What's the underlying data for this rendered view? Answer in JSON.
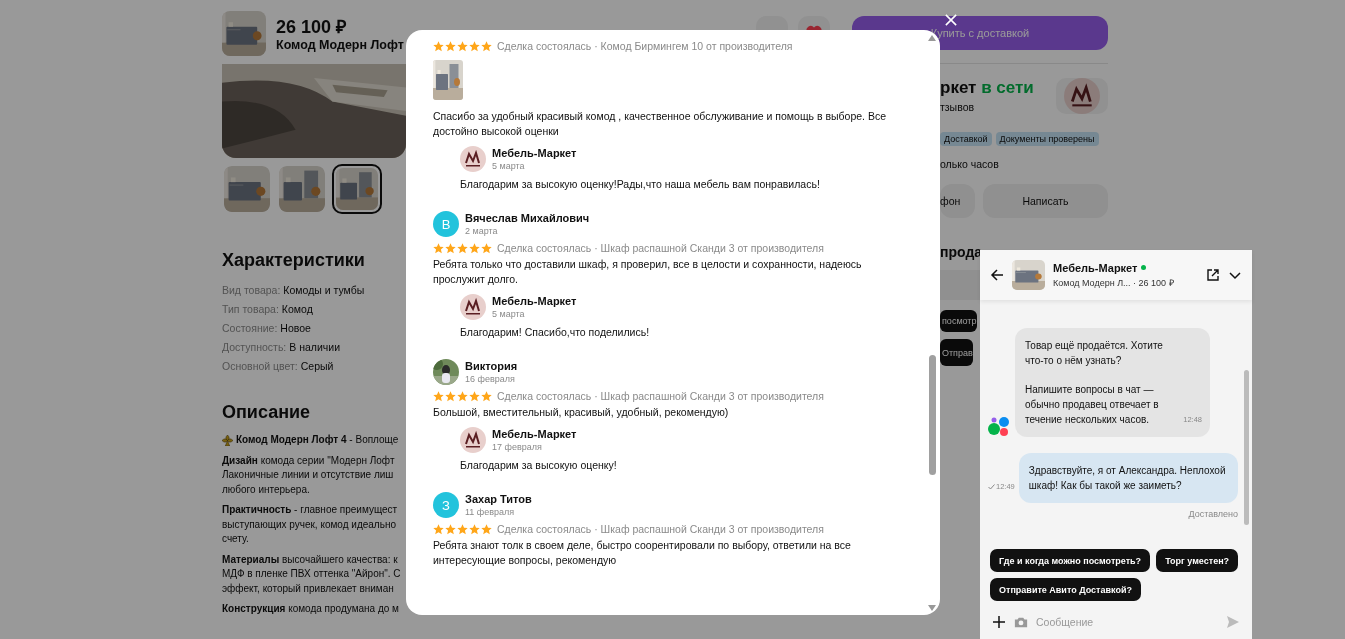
{
  "page": {
    "header": {
      "price": "26 100 ₽",
      "title": "Комод Модерн Лофт"
    },
    "thumbnails": [
      {
        "selected": false
      },
      {
        "selected": false
      },
      {
        "selected": true
      }
    ],
    "specs_title": "Характеристики",
    "specs": [
      {
        "label": "Вид товара:",
        "value": "Комоды и тумбы"
      },
      {
        "label": "Тип товара:",
        "value": "Комод"
      },
      {
        "label": "Состояние:",
        "value": "Новое"
      },
      {
        "label": "Доступность:",
        "value": "В наличии"
      },
      {
        "label": "Основной цвет:",
        "value": "Серый"
      }
    ],
    "description_title": "Описание",
    "description": [
      {
        "kind": "ornament",
        "lines": [
          "**Комод Модерн Лофт 4** - Воплоще"
        ]
      },
      {
        "lines": [
          "**Дизайн** комода серии \"Модерн Лофт",
          "Лаконичные линии и отсутствие лиш",
          "любого интерьера."
        ]
      },
      {
        "lines": [
          "**Практичность** - главное преимущест",
          "выступающих ручек, комод идеально",
          "счету."
        ]
      },
      {
        "lines": [
          "**Материалы** высочайшего качества: к",
          "МДФ в пленке ПВХ оттенка \"Айрон\". С",
          "эффект, который привлекает вниман"
        ]
      },
      {
        "lines": [
          "**Конструкция** комода продумана до м"
        ]
      }
    ],
    "buy_button": "Купить с доставкой",
    "seller": {
      "name": "ркет",
      "status": "в сети",
      "reviews": "тзывов"
    },
    "tags": [
      "Доставкой",
      "Документы проверены"
    ],
    "reply_time": "олько часов",
    "buttons": [
      "фон",
      "Написать"
    ],
    "section_title": "прода",
    "chips": [
      "посмотр",
      "Отправ"
    ]
  },
  "reviews_modal": {
    "reviews": [
      {
        "stars": 5,
        "deal": "Сделка состоялась · Комод Бирмингем 10 от производителя",
        "photo": true,
        "text": "Спасибо за удобный красивый комод , качественное обслуживание и помощь в выборе. Все достойно высокой оценки",
        "reply": {
          "author": "Мебель-Маркет",
          "date": "5 марта",
          "text": "Благодарим за высокую оценку!Рады,что наша мебель вам понравилась!"
        }
      },
      {
        "author": "Вячеслав Михайлович",
        "date": "2 марта",
        "avatar": {
          "kind": "letter",
          "letter": "В",
          "color": "#22c3dc"
        },
        "stars": 5,
        "deal": "Сделка состоялась · Шкаф распашной Сканди 3 от производителя",
        "text": "Ребята только что доставили шкаф, я проверил, все в целости и сохранности, надеюсь прослужит долго.",
        "reply": {
          "author": "Мебель-Маркет",
          "date": "5 марта",
          "text": "Благодарим! Спасибо,что поделились!"
        }
      },
      {
        "author": "Виктория",
        "date": "16 февраля",
        "stars": 5,
        "deal": "Сделка состоялась · Шкаф распашной Сканди 3 от производителя",
        "text": "Большой, вместительный, красивый, удобный, рекомендую)",
        "reply": {
          "author": "Мебель-Маркет",
          "date": "17 февраля",
          "text": "Благодарим за высокую оценку!"
        }
      },
      {
        "author": "Захар Титов",
        "date": "11 февраля",
        "avatar": {
          "kind": "letter",
          "letter": "З",
          "color": "#22c3dc"
        },
        "stars": 5,
        "deal": "Сделка состоялась · Шкаф распашной Сканди 3 от производителя",
        "text": "Ребята знают толк в своем деле, быстро соорентировали по выбору, ответили на все интересующие вопросы, рекомендую"
      }
    ]
  },
  "chat": {
    "seller": "Мебель-Маркет",
    "online": true,
    "subtitle": "Комод Модерн Л... · 26 100 ₽",
    "messages": [
      {
        "kind": "incoming",
        "paragraphs": [
          "Товар ещё продаётся. Хотите что-то о нём узнать?",
          "Напишите вопросы в чат — обычно продавец отвечает в течение нескольких часов."
        ],
        "time": "12:48"
      },
      {
        "kind": "outgoing",
        "paragraphs": [
          "Здравствуйте, я от Александра. Неплохой шкаф! Как бы такой же заиметь?"
        ],
        "time": "12:49",
        "status": "Доставлено"
      }
    ],
    "quick_replies": [
      "Где и когда можно посмотреть?",
      "Торг уместен?",
      "Отправите Авито Доставкой?"
    ],
    "placeholder": "Сообщение"
  }
}
